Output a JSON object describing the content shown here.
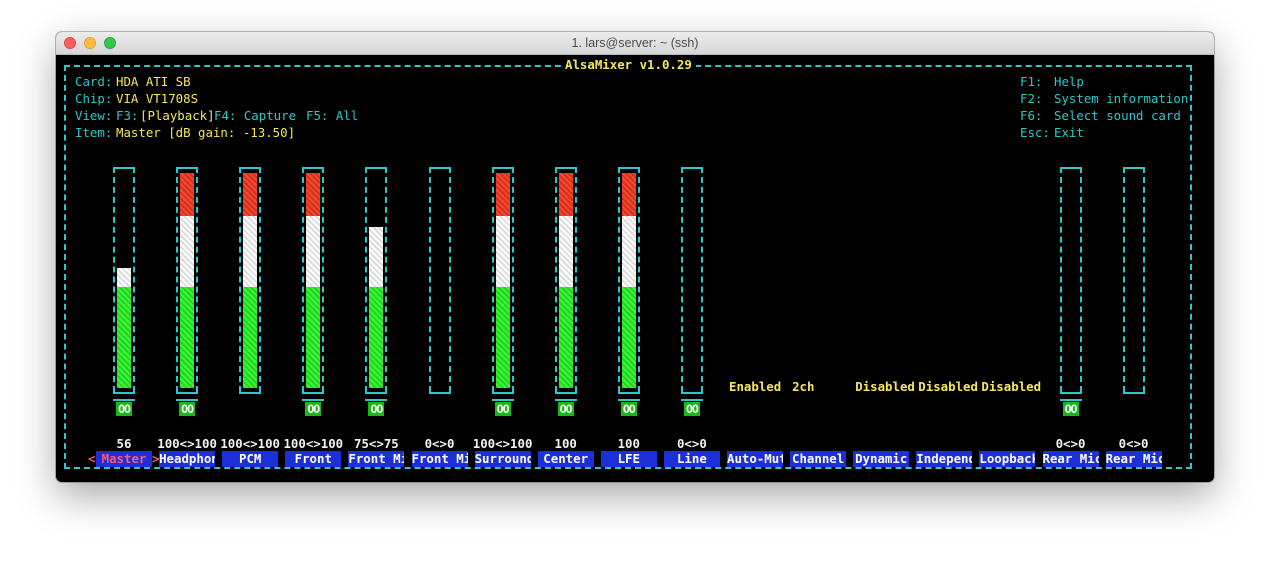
{
  "window": {
    "title": "1. lars@server: ~ (ssh)"
  },
  "app": {
    "title": "AlsaMixer v1.0.29"
  },
  "info": {
    "card_label": "Card:",
    "card_value": "HDA ATI SB",
    "chip_label": "Chip:",
    "chip_value": "VIA VT1708S",
    "view_label": "View:",
    "view_f3": "F3:",
    "view_f3_value": "[Playback]",
    "view_f4": "F4: Capture",
    "view_f5": "F5: All",
    "item_label": "Item:",
    "item_value": "Master [dB gain: -13.50]"
  },
  "keys": [
    {
      "key": "F1:",
      "action": "Help"
    },
    {
      "key": "F2:",
      "action": "System information"
    },
    {
      "key": "F6:",
      "action": "Select sound card"
    },
    {
      "key": "Esc:",
      "action": "Exit"
    }
  ],
  "selection": {
    "left_arrow": "<",
    "right_arrow": ">"
  },
  "channels": [
    {
      "name": "Master",
      "value": "56",
      "level": 0.56,
      "mute": "OO",
      "selected": true
    },
    {
      "name": "Headphon",
      "value": "100<>100",
      "level": 1.0,
      "mute": "OO"
    },
    {
      "name": "PCM",
      "value": "100<>100",
      "level": 1.0,
      "mute": ""
    },
    {
      "name": "Front",
      "value": "100<>100",
      "level": 1.0,
      "mute": "OO"
    },
    {
      "name": "Front Mi",
      "value": "75<>75",
      "level": 0.75,
      "mute": "OO"
    },
    {
      "name": "Front Mi",
      "value": "0<>0",
      "level": 0,
      "mute": ""
    },
    {
      "name": "Surround",
      "value": "100<>100",
      "level": 1.0,
      "mute": "OO"
    },
    {
      "name": "Center",
      "value": "100",
      "level": 1.0,
      "mute": "OO"
    },
    {
      "name": "LFE",
      "value": "100",
      "level": 1.0,
      "mute": "OO"
    },
    {
      "name": "Line",
      "value": "0<>0",
      "level": 0,
      "mute": "OO"
    },
    {
      "name": "Auto-Mut",
      "enum": "Enabled"
    },
    {
      "name": "Channel",
      "enum": "2ch"
    },
    {
      "name": "Dynamic",
      "enum": "Disabled"
    },
    {
      "name": "Independ",
      "enum": "Disabled"
    },
    {
      "name": "Loopback",
      "enum": "Disabled"
    },
    {
      "name": "Rear Mic",
      "value": "0<>0",
      "level": 0,
      "mute": "OO"
    },
    {
      "name": "Rear Mic",
      "value": "0<>0",
      "level": 0,
      "mute": ""
    }
  ],
  "colors": {
    "border": "#2ec8c8",
    "label_bg": "#1d2fd8",
    "bar_green": "#23d41e",
    "bar_white": "#ffffff",
    "bar_red": "#e03c24",
    "info_text": "#f5e65a"
  }
}
